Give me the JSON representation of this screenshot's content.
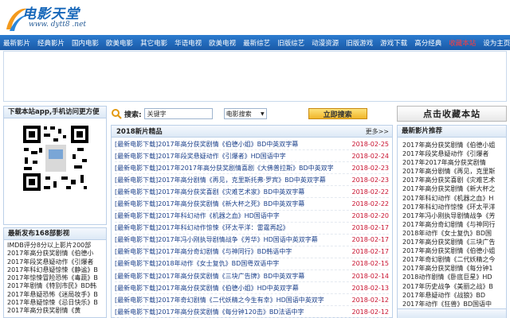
{
  "logo": {
    "title": "电影天堂",
    "url": "www. dytt8 .net"
  },
  "nav": {
    "items": [
      "最新影片",
      "经典影片",
      "国内电影",
      "欧美电影",
      "其它电影",
      "华语电视",
      "欧美电视",
      "最新综艺",
      "旧版综艺",
      "动漫资源",
      "旧版游戏",
      "游戏下载",
      "高分经典",
      "收藏本站",
      "设为主页"
    ],
    "hot_index": 13
  },
  "left": {
    "app_title": "下载本站app,手机访问更方便",
    "latest_title": "最新发布168部影视",
    "latest_items": [
      "IMDB评分8分以上影片200部",
      "2017年高分获奖剧情《伯德小",
      "2017年段奖悬疑动作《引爆者",
      "2017年科幻悬疑惊悚《静谧》B",
      "2017年惊悚冒险恐怖《毒蔬》B",
      "2017年剧情《特别市民》BD韩",
      "2017年悬疑恐怖《迷局妆手》B",
      "2017年悬疑惊悚《忌日快乐》B",
      "2017年高分获奖剧情《黄"
    ]
  },
  "search": {
    "label": "搜索:",
    "placeholder": "关键字",
    "select_value": "电影搜索",
    "button": "立即搜索"
  },
  "list": {
    "title": "2018新片精品",
    "more": "更多>>",
    "rows": [
      {
        "title": "[最新电影下载]2017年高分获奖剧情《伯德小姐》BD中英双字幕",
        "date": "2018-02-25"
      },
      {
        "title": "[最新电影下载]2017年段奖悬疑动作《引爆者》HD国语中字",
        "date": "2018-02-24"
      },
      {
        "title": "[最新电影下载]2017年2017年高分获奖剧情喜剧《大佛普拉斯》BD中英双字",
        "date": "2018-02-23"
      },
      {
        "title": "[最新电影下载]2017年高分剧情《再见，克里斯托弗·罗宾》BD中英双字幕",
        "date": "2018-02-23"
      },
      {
        "title": "[最新电影下载]2017年高分获奖喜剧《灾难艺术家》BD中英双字幕",
        "date": "2018-02-22"
      },
      {
        "title": "[最新电影下载]2017年高分获奖剧情《新大杯之死》BD中英双字幕",
        "date": "2018-02-22"
      },
      {
        "title": "[最新电影下载]2017年科幻动作《机器之血》HD国语中字",
        "date": "2018-02-20"
      },
      {
        "title": "[最新电影下载]2017年科幻动作惊悚《环太平洋：雷霆再起》",
        "date": "2018-02-17"
      },
      {
        "title": "[最新电影下载]2017年冯小刚执导剧情战争《芳华》HD国语中英双字幕",
        "date": "2018-02-17"
      },
      {
        "title": "[最新电影下载]2017年高分奇幻剧情《与神同行》BD韩语中字",
        "date": "2018-02-17"
      },
      {
        "title": "[最新电影下载]2018年动作《女士复仇》BD国粤双语中字",
        "date": "2018-02-15"
      },
      {
        "title": "[最新电影下载]2017年高分获奖剧情《三块广告牌》BD中英双字幕",
        "date": "2018-02-14"
      },
      {
        "title": "[最新电影下载]2017年高分获奖剧情《伯德小姐》HD中英双字幕",
        "date": "2018-02-13"
      },
      {
        "title": "[最新电影下载]2017年奇幻剧情《二代妖精之今生有幸》HD国语中英双字",
        "date": "2018-02-12"
      },
      {
        "title": "[最新电影下载]2017年高分获奖剧情《每分钟120击》BD法语中字",
        "date": "2018-02-12"
      }
    ]
  },
  "right": {
    "fav_button": "点击收藏本站",
    "rec_title": "最新影片推荐",
    "rec_items": [
      "2017年高分获奖剧情《伯德小姐",
      "2017年段奖悬疑动作《引爆者",
      "2017年2017年高分获奖剧情",
      "2017年高分剧情《再见，克里斯",
      "2017年高分获奖喜剧《灾难艺术",
      "2017年高分获奖剧情《新大杯之",
      "2017年科幻动作《机器之血》H",
      "2017年科幻动作惊悚《环太平洋",
      "2017年冯小刚执导剧情战争《芳",
      "2017年高分奇幻剧情《与神同行",
      "2018年动作《女士复仇》BD国",
      "2017年高分获奖剧情《三块广告",
      "2017年高分获奖剧情《伯德小姐",
      "2017年奇幻剧情《二代妖精之今",
      "2017年高分获奖剧情《每分钟1",
      "2018动作剧情《卧底巨星》HD",
      "2017年历史战争《美丽之战》B",
      "2017年悬疑动作《战狼》BD",
      "2017年动作《狂兽》BD国语中"
    ]
  }
}
